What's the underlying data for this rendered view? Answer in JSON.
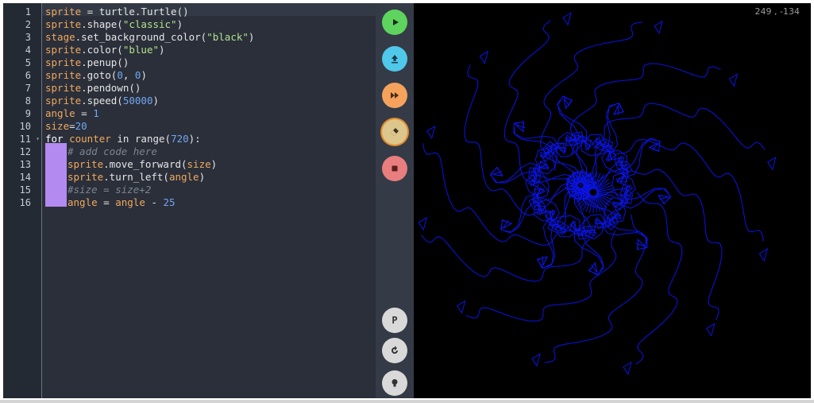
{
  "editor": {
    "line_numbers": [
      "1",
      "2",
      "3",
      "4",
      "5",
      "6",
      "7",
      "8",
      "9",
      "10",
      "11",
      "12",
      "13",
      "14",
      "15",
      "16"
    ],
    "lines": [
      {
        "indent": 0,
        "tokens": [
          {
            "t": "sprite",
            "c": "sp"
          },
          {
            "t": " = turtle.Turtle()",
            "c": ""
          }
        ]
      },
      {
        "indent": 0,
        "tokens": [
          {
            "t": "sprite",
            "c": "sp"
          },
          {
            "t": ".shape(",
            "c": ""
          },
          {
            "t": "\"classic\"",
            "c": "st"
          },
          {
            "t": ")",
            "c": ""
          }
        ]
      },
      {
        "indent": 0,
        "tokens": [
          {
            "t": "stage",
            "c": "sp"
          },
          {
            "t": ".set_background_color(",
            "c": ""
          },
          {
            "t": "\"black\"",
            "c": "st"
          },
          {
            "t": ")",
            "c": ""
          }
        ]
      },
      {
        "indent": 0,
        "tokens": [
          {
            "t": "sprite",
            "c": "sp"
          },
          {
            "t": ".color(",
            "c": ""
          },
          {
            "t": "\"blue\"",
            "c": "st"
          },
          {
            "t": ")",
            "c": ""
          }
        ]
      },
      {
        "indent": 0,
        "tokens": [
          {
            "t": "sprite",
            "c": "sp"
          },
          {
            "t": ".penup()",
            "c": ""
          }
        ]
      },
      {
        "indent": 0,
        "tokens": [
          {
            "t": "sprite",
            "c": "sp"
          },
          {
            "t": ".goto(",
            "c": ""
          },
          {
            "t": "0",
            "c": "nm"
          },
          {
            "t": ", ",
            "c": ""
          },
          {
            "t": "0",
            "c": "nm"
          },
          {
            "t": ")",
            "c": ""
          }
        ]
      },
      {
        "indent": 0,
        "tokens": [
          {
            "t": "sprite",
            "c": "sp"
          },
          {
            "t": ".pendown()",
            "c": ""
          }
        ]
      },
      {
        "indent": 0,
        "tokens": [
          {
            "t": "sprite",
            "c": "sp"
          },
          {
            "t": ".speed(",
            "c": ""
          },
          {
            "t": "50000",
            "c": "nm"
          },
          {
            "t": ")",
            "c": ""
          }
        ]
      },
      {
        "indent": 0,
        "tokens": [
          {
            "t": "angle",
            "c": "sp"
          },
          {
            "t": " = ",
            "c": ""
          },
          {
            "t": "1",
            "c": "nm"
          }
        ]
      },
      {
        "indent": 0,
        "tokens": [
          {
            "t": "size",
            "c": "sp"
          },
          {
            "t": "=",
            "c": ""
          },
          {
            "t": "20",
            "c": "nm"
          }
        ]
      },
      {
        "indent": 0,
        "tokens": [
          {
            "t": "for",
            "c": "kw"
          },
          {
            "t": " ",
            "c": ""
          },
          {
            "t": "counter",
            "c": "sp"
          },
          {
            "t": " in range(",
            "c": ""
          },
          {
            "t": "720",
            "c": "nm"
          },
          {
            "t": "):",
            "c": ""
          }
        ]
      },
      {
        "indent": 1,
        "tokens": [
          {
            "t": "# add code here",
            "c": "cm"
          }
        ]
      },
      {
        "indent": 1,
        "tokens": [
          {
            "t": "sprite",
            "c": "sp"
          },
          {
            "t": ".move_forward(",
            "c": ""
          },
          {
            "t": "size",
            "c": "sp"
          },
          {
            "t": ")",
            "c": ""
          }
        ]
      },
      {
        "indent": 1,
        "tokens": [
          {
            "t": "sprite",
            "c": "sp"
          },
          {
            "t": ".turn_left(",
            "c": ""
          },
          {
            "t": "angle",
            "c": "sp"
          },
          {
            "t": ")",
            "c": ""
          }
        ]
      },
      {
        "indent": 1,
        "tokens": [
          {
            "t": "#size = size+2",
            "c": "cm"
          }
        ]
      },
      {
        "indent": 1,
        "tokens": [
          {
            "t": "angle",
            "c": "sp"
          },
          {
            "t": " = ",
            "c": ""
          },
          {
            "t": "angle",
            "c": "sp"
          },
          {
            "t": " - ",
            "c": ""
          },
          {
            "t": "25",
            "c": "nm"
          }
        ]
      }
    ]
  },
  "toolbar": {
    "buttons": [
      {
        "name": "run-button",
        "icon": "play-icon",
        "color": "#5ed45e"
      },
      {
        "name": "upload-button",
        "icon": "upload-icon",
        "color": "#4fc8ea"
      },
      {
        "name": "fast-forward-button",
        "icon": "fast-forward-icon",
        "color": "#f5a25d"
      },
      {
        "name": "eraser-button",
        "icon": "eraser-icon",
        "color": "#dcc68b"
      },
      {
        "name": "stop-button",
        "icon": "stop-icon",
        "color": "#e87e7e"
      }
    ],
    "bottom_buttons": [
      {
        "name": "p-button",
        "icon": "p-icon",
        "label": "P"
      },
      {
        "name": "reset-button",
        "icon": "rotate-icon"
      },
      {
        "name": "hint-button",
        "icon": "lightbulb-icon"
      }
    ]
  },
  "stage": {
    "coords": "249 , -134",
    "pen_color": "#0a14e6",
    "background": "#000000"
  }
}
